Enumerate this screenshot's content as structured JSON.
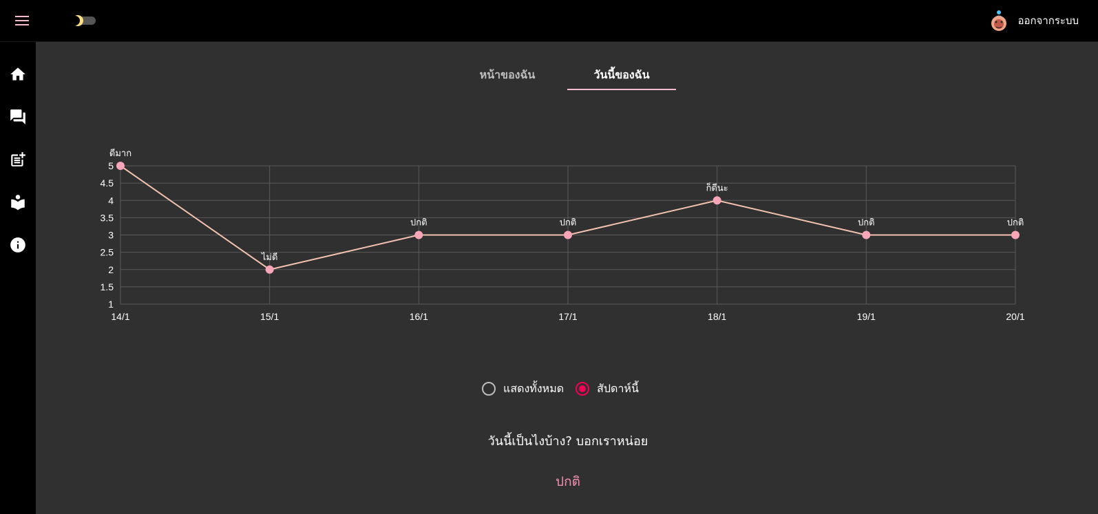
{
  "header": {
    "logout_label": "ออกจากระบบ",
    "menu_icon": "menu-icon",
    "theme_toggle": "dark-mode-toggle"
  },
  "sidebar": {
    "items": [
      {
        "icon": "home-icon"
      },
      {
        "icon": "forum-icon"
      },
      {
        "icon": "post-add-icon"
      },
      {
        "icon": "reading-icon"
      },
      {
        "icon": "info-icon"
      }
    ]
  },
  "tabs": [
    {
      "label": "หน้าของฉัน",
      "active": false
    },
    {
      "label": "วันนี้ของฉัน",
      "active": true
    }
  ],
  "colors": {
    "accent": "#f8bbd0",
    "line": "#f5c4b0",
    "point": "#f8a5b8",
    "radio_selected": "#f50057",
    "answer": "#f48fb1"
  },
  "chart_data": {
    "type": "line",
    "x": [
      "14/1",
      "15/1",
      "16/1",
      "17/1",
      "18/1",
      "19/1",
      "20/1"
    ],
    "values": [
      5,
      2,
      3,
      3,
      4,
      3,
      3
    ],
    "point_labels": [
      "ดีมาก",
      "ไม่ดี",
      "ปกติ",
      "ปกติ",
      "ก็ดีนะ",
      "ปกติ",
      "ปกติ"
    ],
    "yticks": [
      "1",
      "1.5",
      "2",
      "2.5",
      "3",
      "3.5",
      "4",
      "4.5",
      "5"
    ],
    "ylim": [
      1,
      5
    ],
    "grid": true,
    "title": "",
    "xlabel": "",
    "ylabel": ""
  },
  "filter": {
    "options": [
      {
        "label": "แสดงทั้งหมด",
        "selected": false
      },
      {
        "label": "สัปดาห์นี้",
        "selected": true
      }
    ]
  },
  "prompt": {
    "question": "วันนี้เป็นไงบ้าง? บอกเราหน่อย",
    "answer": "ปกติ"
  }
}
